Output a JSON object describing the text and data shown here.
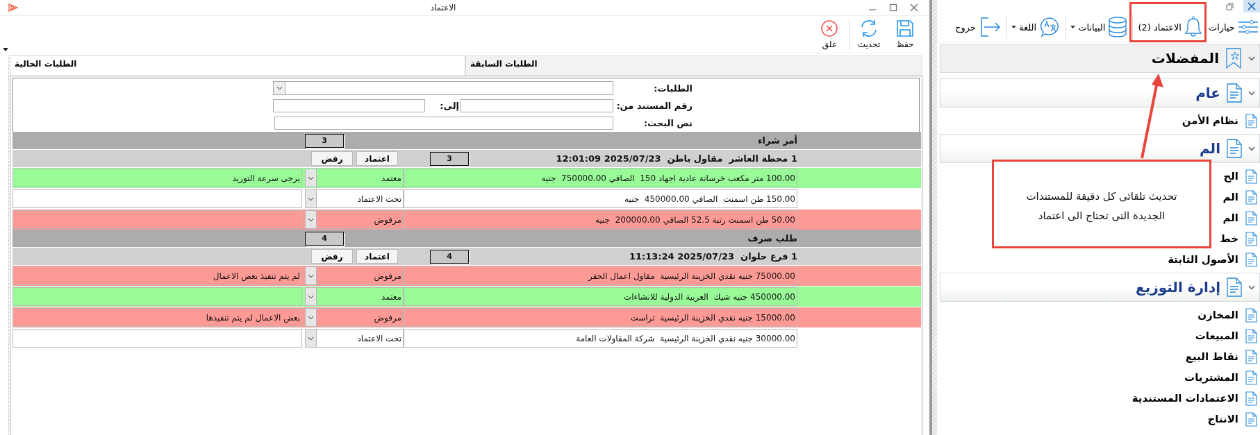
{
  "window": {
    "title": "الاعتماد"
  },
  "toolbar": [
    {
      "kind": "save",
      "label": "حفظ"
    },
    {
      "kind": "refresh",
      "label": "تحديث"
    },
    {
      "kind": "close",
      "label": "غلق"
    }
  ],
  "tabs": [
    {
      "label": "الطلبات السابقة",
      "selected": false
    },
    {
      "label": "الطلبات الحالية",
      "selected": true
    }
  ],
  "filters": {
    "requests_label": "الطلبات:",
    "doc_from_label": "رقم المستند من:",
    "to_label": "إلى:",
    "search_label": "نص البحث:"
  },
  "groups": [
    {
      "title": "أمر شراء",
      "count": "3",
      "documents": [
        {
          "header": "1 محطة العاشر  مقاول باطن  2025/07/23 12:01:09",
          "count": "3",
          "approve": "اعتماد",
          "reject": "رفض",
          "lines": [
            {
              "description": "100.00 متر مكعب خرسانة عادية اجهاد 150  الصافي 750000.00  جنيه",
              "status": "معتمد",
              "kind": "approved",
              "note": "يرجى سرعة التوريد"
            },
            {
              "description": "150.00 طن اسمنت  الصافي 450000.00  جنيه",
              "status": "تحت الاعتماد",
              "kind": "pending"
            },
            {
              "description": "50.00 طن اسمنت رتبة 52.5 الصافي 200000.00  جنيه",
              "status": "مرفوض",
              "kind": "rejected"
            }
          ]
        }
      ]
    },
    {
      "title": "طلب صرف",
      "count": "4",
      "documents": [
        {
          "header": "1 فرع حلوان  2025/07/23 11:13:24",
          "count": "4",
          "approve": "اعتماد",
          "reject": "رفض",
          "lines": [
            {
              "description": "75000.00 جنيه نقدي الخزينة الرئيسية  مقاول اعمال الحفر",
              "status": "مرفوض",
              "kind": "rejected",
              "note": "لم يتم تنفيذ بعض الاعمال"
            },
            {
              "description": "450000.00 جنيه شيك  العربية الدولية للانشاءات",
              "status": "معتمد",
              "kind": "approved"
            },
            {
              "description": "15000.00 جنيه نقدي الخزينة الرئيسية  تراست",
              "status": "مرفوض",
              "kind": "rejected",
              "note": "بعض الاعمال لم يتم تنفيذها"
            },
            {
              "description": "30000.00 جنيه نقدي الخزينة الرئيسية  شركة المقاولات العامة",
              "status": "تحت الاعتماد",
              "kind": "pending"
            }
          ]
        }
      ]
    }
  ],
  "app_toolbar": [
    {
      "kind": "options",
      "label": "خيارات",
      "dropdown": false
    },
    {
      "kind": "bell",
      "label": "الاعتماد (2)",
      "dropdown": false
    },
    {
      "kind": "database",
      "label": "البيانات",
      "dropdown": true
    },
    {
      "kind": "language",
      "label": "اللغة",
      "dropdown": true
    },
    {
      "kind": "exit",
      "label": "خروج",
      "dropdown": false
    }
  ],
  "sidebar": [
    {
      "title": "المفضلات",
      "kind": "favorites"
    },
    {
      "title": "عام",
      "kind": "module",
      "children": [
        {
          "label": "نظام الأمن"
        }
      ]
    },
    {
      "title": "الم",
      "kind": "module",
      "children": [
        {
          "label": "الح"
        },
        {
          "label": "الم"
        },
        {
          "label": "الم"
        },
        {
          "label": "خط"
        },
        {
          "label": "الأصول الثابتة"
        }
      ]
    },
    {
      "title": "إدارة التوزيع",
      "kind": "module",
      "children": [
        {
          "label": "المخازن"
        },
        {
          "label": "المبيعات"
        },
        {
          "label": "نقاط البيع"
        },
        {
          "label": "المشتريات"
        },
        {
          "label": "الاعتمادات المستندية"
        },
        {
          "label": "الانتاج"
        }
      ]
    }
  ],
  "annotation": {
    "callout": "تحديث تلقائى كل دقيقة للمستندات الجديدة التى تحتاج الى اعتماد"
  }
}
